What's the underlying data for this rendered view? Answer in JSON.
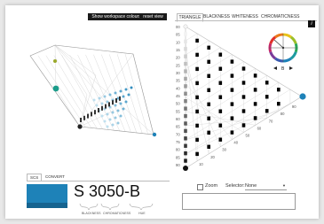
{
  "toolbar": {
    "show_workspace_colours": "Show workspace colours",
    "reset_view": "reset view"
  },
  "tabs": [
    "TRIANGLE",
    "BLACKNESS",
    "WHITENESS",
    "CHROMATICNESS"
  ],
  "info_label": "i",
  "scs_tabs": [
    "SCS",
    "CONVERT"
  ],
  "colour": {
    "code": "S 3050-B",
    "swatch_color": "#1e82b8",
    "swatch_dark": "#15638f"
  },
  "code_parts": [
    "BLACKNESS",
    "CHROMATICNESS",
    "HUE"
  ],
  "triangle": {
    "blackness_scale": [
      "00",
      "05",
      "10",
      "15",
      "20",
      "25",
      "30",
      "35",
      "40",
      "45",
      "50",
      "55",
      "60",
      "65",
      "70",
      "75",
      "80",
      "85",
      "90"
    ],
    "chromaticness_scale": [
      "10",
      "20",
      "30",
      "40",
      "50",
      "60",
      "70",
      "80",
      "90"
    ]
  },
  "hue_wheel": {
    "selected_hue": "B"
  },
  "zoom": {
    "label": "Zoom",
    "checked": false
  },
  "selector": {
    "label": "Selector:",
    "value": "None"
  },
  "colors": {
    "accent": "#1e82b8",
    "selected": "#1e82b8"
  }
}
